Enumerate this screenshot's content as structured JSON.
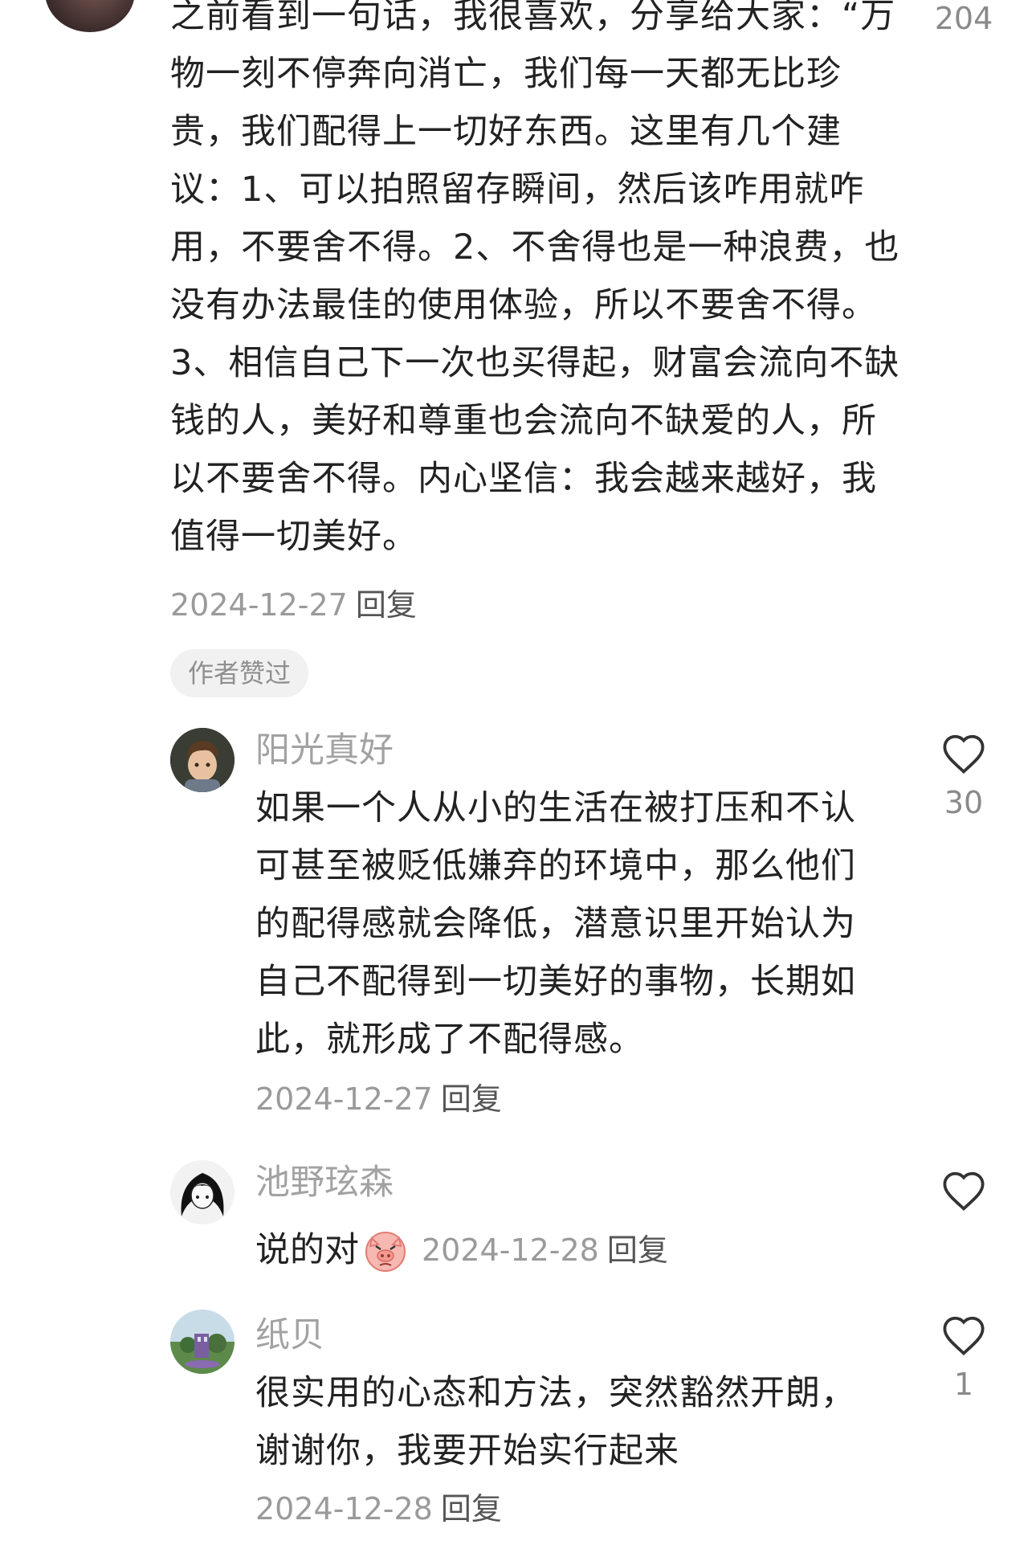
{
  "top_comment": {
    "text": "之前看到一句话，我很喜欢，分享给大家：“万物一刻不停奔向消亡，我们每一天都无比珍贵，我们配得上一切好东西。这里有几个建议：1、可以拍照留存瞬间，然后该咋用就咋用，不要舍不得。2、不舍得也是一种浪费，也没有办法最佳的使用体验，所以不要舍不得。3、相信自己下一次也买得起，财富会流向不缺钱的人，美好和尊重也会流向不缺爱的人，所以不要舍不得。内心坚信：我会越来越好，我值得一切美好。",
    "date": "2024-12-27",
    "reply_label": "回复",
    "like_count": "204",
    "author_liked_badge": "作者赞过"
  },
  "replies": [
    {
      "username": "阳光真好",
      "text": "如果一个人从小的生活在被打压和不认可甚至被贬低嫌弃的环境中，那么他们的配得感就会降低，潜意识里开始认为自己不配得到一切美好的事物，长期如此，就形成了不配得感。",
      "date": "2024-12-27",
      "reply_label": "回复",
      "like_count": "30"
    },
    {
      "username": "池野玹森",
      "text": "说的对",
      "emoji": "pig-face-emoji",
      "date": "2024-12-28",
      "reply_label": "回复",
      "like_count": ""
    },
    {
      "username": "纸贝",
      "text": "很实用的心态和方法，突然豁然开朗，谢谢你，我要开始实行起来",
      "date": "2024-12-28",
      "reply_label": "回复",
      "like_count": "1"
    }
  ],
  "colors": {
    "text": "#222222",
    "muted": "#9a9a9a",
    "username": "#a2a2a2",
    "badge_bg": "#f1f1f1"
  }
}
